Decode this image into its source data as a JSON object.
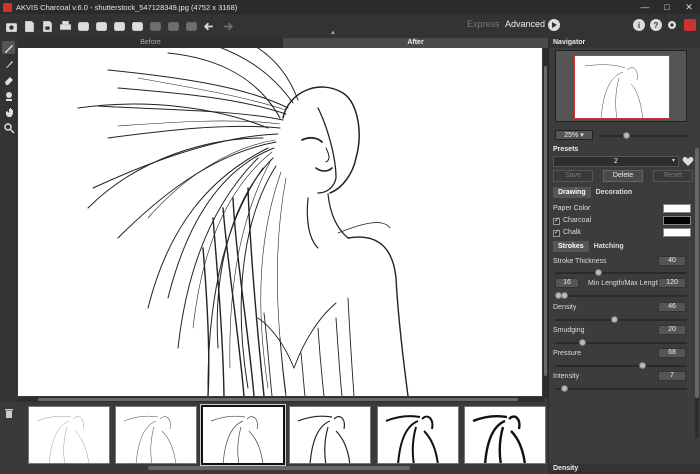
{
  "window": {
    "title": "AKVIS Charcoal v.6.0 - shutterstock_547128349.jpg (4752 x 3168)",
    "controls": [
      "—",
      "□",
      "✕"
    ]
  },
  "toolbar": {
    "mode_express": "Express",
    "mode_advanced": "Advanced",
    "info": "i",
    "help": "?"
  },
  "view_tabs": {
    "before": "Before",
    "after": "After"
  },
  "navigator": {
    "title": "Navigator",
    "zoom": "25%",
    "zoom_arrow": "▾"
  },
  "presets": {
    "title": "Presets",
    "selected": "2",
    "arrow": "▾",
    "save": "Save",
    "delete": "Delete",
    "reset": "Reset"
  },
  "tabs_main": {
    "drawing": "Drawing",
    "decoration": "Decoration"
  },
  "colors": {
    "paper_label": "Paper Color",
    "paper": "#ffffff",
    "charcoal_label": "Charcoal",
    "charcoal": "#000000",
    "chalk_label": "Chalk",
    "chalk": "#ffffff"
  },
  "tabs_sub": {
    "strokes": "Strokes",
    "hatching": "Hatching"
  },
  "params": {
    "stroke_thickness": {
      "label": "Stroke Thickness",
      "value": "40"
    },
    "min_length": "16",
    "length_label": "Min Length/Max Length",
    "max_length": "120",
    "density": {
      "label": "Density",
      "value": "46"
    },
    "smudging": {
      "label": "Smudging",
      "value": "20"
    },
    "pressure": {
      "label": "Pressure",
      "value": "68"
    },
    "intensity": {
      "label": "Intensity",
      "value": "7"
    }
  },
  "footer_section": "Density"
}
